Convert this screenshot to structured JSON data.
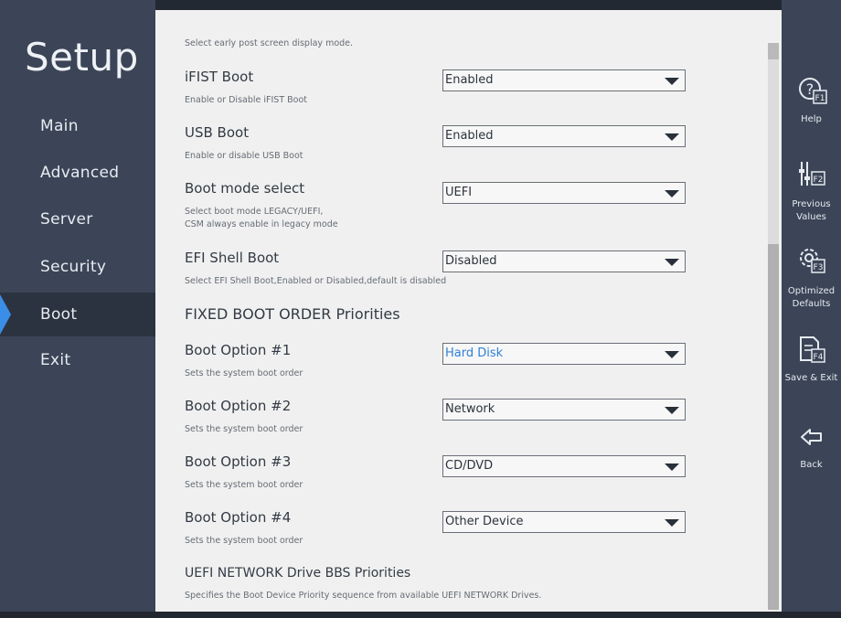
{
  "app": {
    "title": "Setup"
  },
  "menu": {
    "items": [
      {
        "label": "Main"
      },
      {
        "label": "Advanced"
      },
      {
        "label": "Server"
      },
      {
        "label": "Security"
      },
      {
        "label": "Boot",
        "active": true
      },
      {
        "label": "Exit"
      }
    ]
  },
  "content": {
    "clipped_help": "Select early post screen display mode.",
    "settings": [
      {
        "title": "iFIST Boot",
        "help": "Enable or Disable iFIST Boot",
        "value": "Enabled"
      },
      {
        "title": "USB Boot",
        "help": "Enable or disable USB Boot",
        "value": "Enabled"
      },
      {
        "title": "Boot mode select",
        "help_line1": "Select boot mode LEGACY/UEFI,",
        "help_line2": "CSM always enable in legacy mode",
        "value": "UEFI"
      },
      {
        "title": "EFI Shell Boot",
        "help": "Select EFI Shell Boot,Enabled or Disabled,default is disabled",
        "value": "Disabled"
      }
    ],
    "section_fixed": "FIXED BOOT ORDER Priorities",
    "boot_options": [
      {
        "title": "Boot Option #1",
        "help": "Sets the system boot order",
        "value": "Hard Disk"
      },
      {
        "title": "Boot Option #2",
        "help": "Sets the system boot order",
        "value": "Network"
      },
      {
        "title": "Boot Option #3",
        "help": "Sets the system boot order",
        "value": "CD/DVD"
      },
      {
        "title": "Boot Option #4",
        "help": "Sets the system boot order",
        "value": "Other Device"
      }
    ],
    "uefi_network": {
      "title": "UEFI NETWORK Drive BBS Priorities",
      "help": "Specifies the Boot Device Priority sequence from available UEFI NETWORK Drives."
    }
  },
  "functions": {
    "help": {
      "key": "F1",
      "label": "Help"
    },
    "previous": {
      "key": "F2",
      "label_line1": "Previous",
      "label_line2": "Values"
    },
    "optimized": {
      "key": "F3",
      "label_line1": "Optimized",
      "label_line2": "Defaults"
    },
    "save": {
      "key": "F4",
      "label": "Save & Exit"
    },
    "back": {
      "label": "Back"
    }
  },
  "colors": {
    "nav_bg": "#3b4557",
    "active_accent": "#3b8ee8",
    "panel_bg": "#f0f0f0",
    "highlight_value": "#2f7fd8"
  }
}
